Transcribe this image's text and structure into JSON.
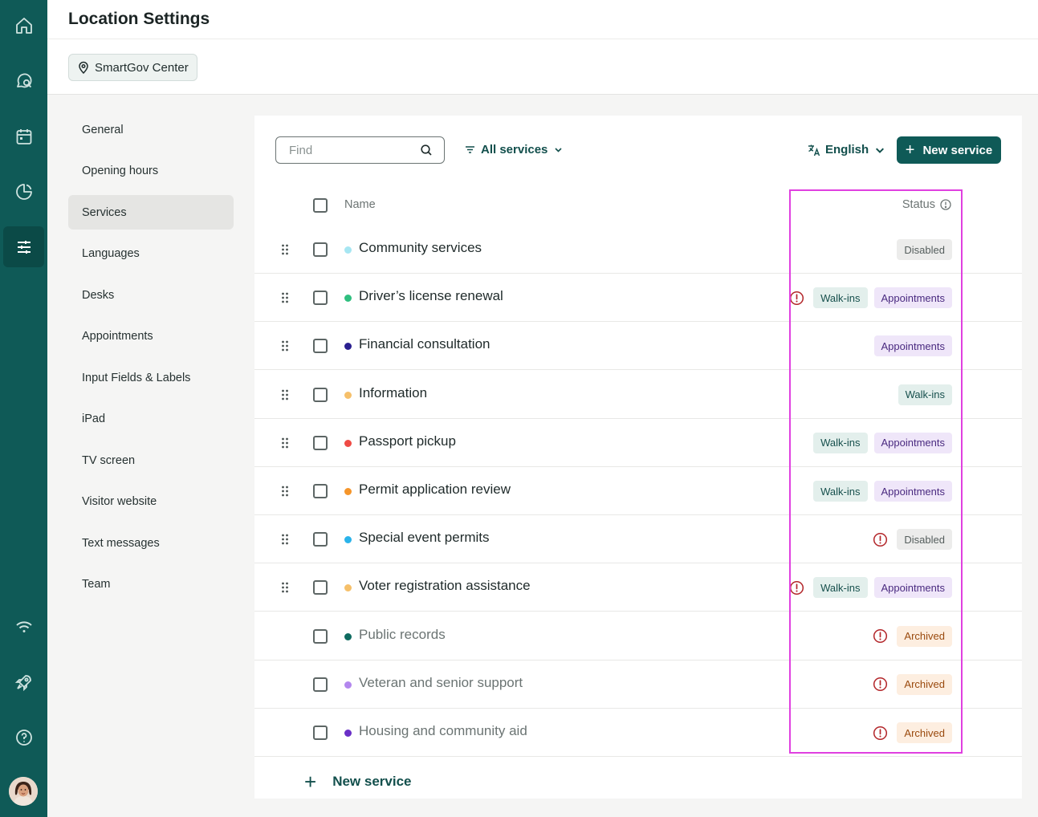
{
  "sidebar_rail": {
    "items": [
      {
        "icon": "home-icon"
      },
      {
        "icon": "chat-search-icon"
      },
      {
        "icon": "calendar-icon"
      },
      {
        "icon": "chart-pie-icon"
      },
      {
        "icon": "sliders-icon",
        "active": true
      },
      {
        "icon": "wifi-icon"
      },
      {
        "icon": "rocket-icon"
      },
      {
        "icon": "help-icon"
      }
    ],
    "avatar_icon": "user-avatar"
  },
  "header": {
    "title": "Location Settings",
    "location_chip": "SmartGov Center"
  },
  "settings_nav": {
    "items": [
      {
        "label": "General"
      },
      {
        "label": "Opening hours"
      },
      {
        "label": "Services",
        "active": true
      },
      {
        "label": "Languages"
      },
      {
        "label": "Desks"
      },
      {
        "label": "Appointments"
      },
      {
        "label": "Input Fields & Labels"
      },
      {
        "label": "iPad"
      },
      {
        "label": "TV screen"
      },
      {
        "label": "Visitor website"
      },
      {
        "label": "Text messages"
      },
      {
        "label": "Team"
      }
    ]
  },
  "toolbar": {
    "find_placeholder": "Find",
    "filter_label": "All services",
    "language_label": "English",
    "new_service_label": "New service"
  },
  "table": {
    "columns": {
      "name": "Name",
      "status": "Status"
    },
    "rows": [
      {
        "name": "Community services",
        "color": "#a6e6f2",
        "draggable": true,
        "warning": false,
        "badges": [
          "Disabled"
        ]
      },
      {
        "name": "Driver’s license renewal",
        "color": "#2fbf7f",
        "draggable": true,
        "warning": true,
        "badges": [
          "Walk-ins",
          "Appointments"
        ]
      },
      {
        "name": "Financial consultation",
        "color": "#2a1f8f",
        "draggable": true,
        "warning": false,
        "badges": [
          "Appointments"
        ]
      },
      {
        "name": "Information",
        "color": "#f6c06a",
        "draggable": true,
        "warning": false,
        "badges": [
          "Walk-ins"
        ]
      },
      {
        "name": "Passport pickup",
        "color": "#ef4b45",
        "draggable": true,
        "warning": false,
        "badges": [
          "Walk-ins",
          "Appointments"
        ]
      },
      {
        "name": "Permit application review",
        "color": "#f5952a",
        "draggable": true,
        "warning": false,
        "badges": [
          "Walk-ins",
          "Appointments"
        ]
      },
      {
        "name": "Special event permits",
        "color": "#2ab3ea",
        "draggable": true,
        "warning": true,
        "badges": [
          "Disabled"
        ]
      },
      {
        "name": "Voter registration assistance",
        "color": "#f6c06a",
        "draggable": true,
        "warning": true,
        "badges": [
          "Walk-ins",
          "Appointments"
        ]
      },
      {
        "name": "Public records",
        "color": "#0f6b60",
        "draggable": false,
        "muted": true,
        "warning": true,
        "badges": [
          "Archived"
        ]
      },
      {
        "name": "Veteran and senior support",
        "color": "#b387ee",
        "draggable": false,
        "muted": true,
        "warning": true,
        "badges": [
          "Archived"
        ]
      },
      {
        "name": "Housing and community aid",
        "color": "#6a2fc7",
        "draggable": false,
        "muted": true,
        "warning": true,
        "badges": [
          "Archived"
        ]
      }
    ],
    "add_label": "New service"
  },
  "colors": {
    "brand": "#0f5a57",
    "warning": "#b3262a",
    "highlight": "#e040e0"
  }
}
